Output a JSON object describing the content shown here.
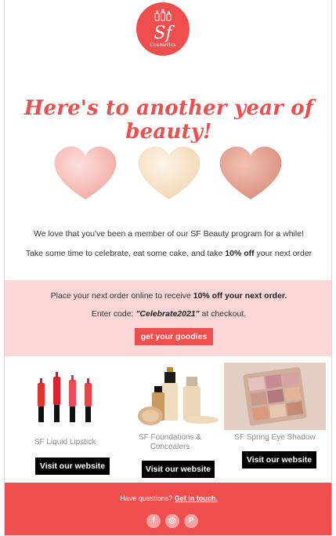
{
  "logo": {
    "initials": "Sf",
    "subtitle": "Cosmetics"
  },
  "headline": "Here's to another year of beauty!",
  "intro": {
    "line1": "We love that you've been a member of our SF Beauty program for a while!",
    "line2_pre": "Take some time to celebrate, eat some cake, and take ",
    "line2_bold": "10% off",
    "line2_post": " your next order"
  },
  "promo": {
    "line1_pre": "Place your next order online to receive ",
    "line1_bold": "10% off your next order.",
    "line2_pre": "Enter code: ",
    "code": "\"Celebrate2021\"",
    "line2_post": " at checkout.",
    "cta_label": "get your goodies"
  },
  "products": [
    {
      "name": "SF Liquid Lipstick",
      "button": "Visit our website"
    },
    {
      "name": "SF Foundations & Concealers",
      "button": "Visit our website"
    },
    {
      "name": "SF Spring Eye Shadow",
      "button": "Visit our website"
    }
  ],
  "footer": {
    "question": "Have questions? ",
    "link": "Get in touch.",
    "social": [
      {
        "icon": "facebook-icon",
        "glyph": "f"
      },
      {
        "icon": "instagram-icon",
        "glyph": "◎"
      },
      {
        "icon": "pinterest-icon",
        "glyph": "P"
      }
    ]
  },
  "colors": {
    "brand": "#f04e4e",
    "pink_band": "#fbd7d7",
    "social_dot": "#f7a3a3"
  }
}
